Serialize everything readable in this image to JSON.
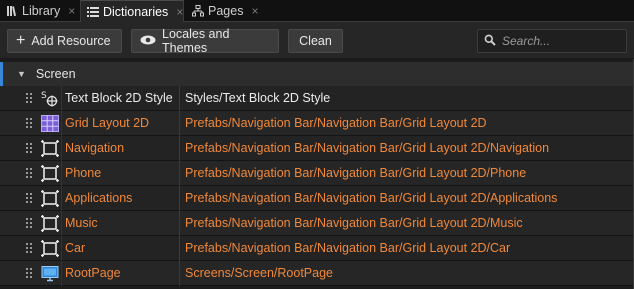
{
  "tabs": [
    {
      "label": "Library",
      "close": "×",
      "icon": "library-icon",
      "active": false
    },
    {
      "label": "Dictionaries",
      "close": "×",
      "icon": "dictionary-icon",
      "active": true
    },
    {
      "label": "Pages",
      "close": "×",
      "icon": "pages-icon",
      "active": false
    }
  ],
  "toolbar": {
    "add_resource": "Add Resource",
    "locales_themes": "Locales and Themes",
    "clean": "Clean",
    "search_placeholder": "Search..."
  },
  "group": {
    "title": "Screen",
    "expanded": true,
    "accent": "#3a87d6"
  },
  "colors": {
    "link_orange": "#f0883a",
    "text_white": "#ececec"
  },
  "rows": [
    {
      "name": "Text Block 2D Style",
      "path": "Styles/Text Block 2D Style",
      "icon": "style-icon",
      "tone": "white"
    },
    {
      "name": "Grid Layout 2D",
      "path": "Prefabs/Navigation Bar/Navigation Bar/Grid Layout 2D",
      "icon": "grid-layout-icon",
      "tone": "orange"
    },
    {
      "name": "Navigation",
      "path": "Prefabs/Navigation Bar/Navigation Bar/Grid Layout 2D/Navigation",
      "icon": "node-icon",
      "tone": "orange"
    },
    {
      "name": "Phone",
      "path": "Prefabs/Navigation Bar/Navigation Bar/Grid Layout 2D/Phone",
      "icon": "node-icon",
      "tone": "orange"
    },
    {
      "name": "Applications",
      "path": "Prefabs/Navigation Bar/Navigation Bar/Grid Layout 2D/Applications",
      "icon": "node-icon",
      "tone": "orange"
    },
    {
      "name": "Music",
      "path": "Prefabs/Navigation Bar/Navigation Bar/Grid Layout 2D/Music",
      "icon": "node-icon",
      "tone": "orange"
    },
    {
      "name": "Car",
      "path": "Prefabs/Navigation Bar/Navigation Bar/Grid Layout 2D/Car",
      "icon": "node-icon",
      "tone": "orange"
    },
    {
      "name": "RootPage",
      "path": "Screens/Screen/RootPage",
      "icon": "page-icon",
      "tone": "orange"
    }
  ]
}
